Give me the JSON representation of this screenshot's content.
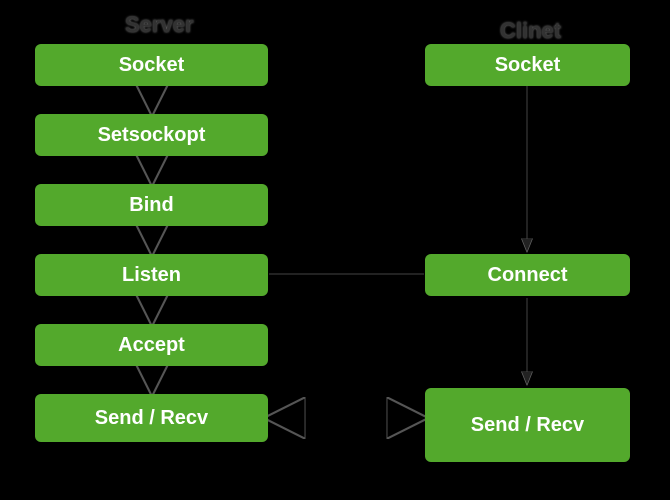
{
  "diagram": {
    "columns": {
      "server": {
        "title": "Server"
      },
      "client": {
        "title": "Clinet"
      }
    },
    "server_steps": {
      "socket": "Socket",
      "setsockopt": "Setsockopt",
      "bind": "Bind",
      "listen": "Listen",
      "accept": "Accept",
      "sendrecv": "Send / Recv"
    },
    "client_steps": {
      "socket": "Socket",
      "connect": "Connect",
      "sendrecv": "Send / Recv"
    },
    "colors": {
      "box_bg": "#53a92c",
      "box_fg": "#ffffff",
      "page_bg": "#000000",
      "title_fg": "#323232"
    }
  }
}
